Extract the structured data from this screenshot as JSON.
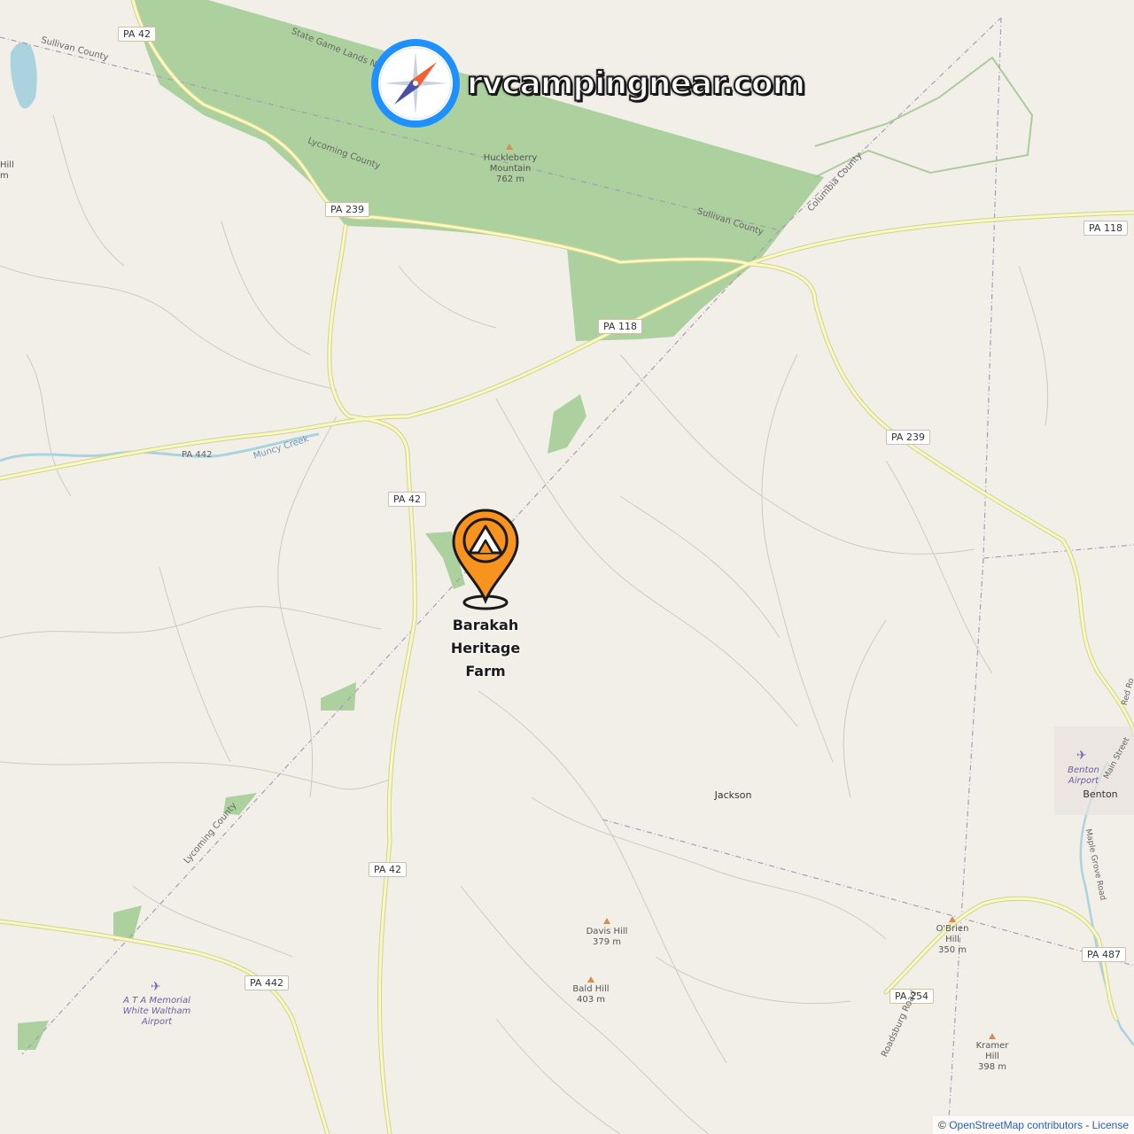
{
  "brand": {
    "text": "rvcampingnear.com"
  },
  "location": {
    "name": "Barakah\nHeritage\nFarm",
    "pin_icon": "camp-tent-pin-icon",
    "pin_color": "#f7931e"
  },
  "colors": {
    "land": "#f2efe9",
    "forest": "#add19e",
    "road_primary": "#f7fabf",
    "road_casing": "#d3cf96",
    "water": "#aad3df"
  },
  "road_shields": [
    "PA 42",
    "PA 239",
    "PA 118",
    "PA 239",
    "PA 42",
    "PA 42",
    "PA 442",
    "PA 118",
    "PA 487",
    "PA 254"
  ],
  "labels": {
    "state_game_lands": "State Game Lands Nu",
    "sullivan_county_nw": "Sullivan County",
    "lycoming_county_n": "Lycoming County",
    "sullivan_county_ne": "Sullivan County",
    "columbia_county": "Columbia County",
    "lycoming_county_s": "Lycoming County",
    "muncy_creek": "Muncy Creek",
    "roadsburg_road": "Roadsburg Road",
    "maple_grove_road": "Maple Grove Road",
    "main_street": "Main Street",
    "red_rock": "Red Ro",
    "pa_442_partial": "PA 442",
    "hill_left_top": "Hill",
    "hill_left_bottom": "m"
  },
  "peaks": [
    {
      "name": "Huckleberry\nMountain",
      "elevation": "762 m"
    },
    {
      "name": "Davis Hill",
      "elevation": "379 m"
    },
    {
      "name": "Bald Hill",
      "elevation": "403 m"
    },
    {
      "name": "O'Brien\nHill",
      "elevation": "350 m"
    },
    {
      "name": "Kramer\nHill",
      "elevation": "398 m"
    }
  ],
  "places": {
    "jackson": "Jackson",
    "benton": "Benton"
  },
  "airports": [
    {
      "name": "A T A Memorial\nWhite Waltham\nAirport",
      "icon": "airport-icon"
    },
    {
      "name": "Benton\nAirport",
      "icon": "airport-icon"
    }
  ],
  "attribution": {
    "symbol": "©",
    "osm_text": "OpenStreetMap contributors",
    "separator": " - ",
    "license_text": "License"
  }
}
